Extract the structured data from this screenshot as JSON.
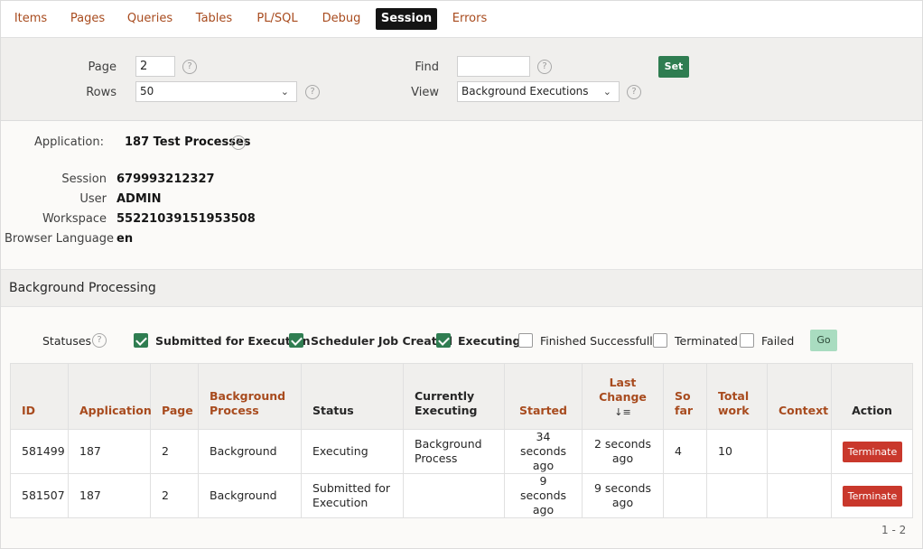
{
  "tabs": [
    "Items",
    "Pages",
    "Queries",
    "Tables",
    "PL/SQL",
    "Debug",
    "Session",
    "Errors"
  ],
  "active_tab": "Session",
  "filters": {
    "page_label": "Page",
    "page_value": "2",
    "rows_label": "Rows",
    "rows_value": "50",
    "find_label": "Find",
    "find_value": "",
    "view_label": "View",
    "view_value": "Background Executions",
    "set_label": "Set",
    "help_glyph": "?"
  },
  "info": {
    "application_label": "Application:",
    "application_value": "187 Test Processes",
    "session_label": "Session",
    "session_value": "679993212327",
    "user_label": "User",
    "user_value": "ADMIN",
    "workspace_label": "Workspace",
    "workspace_value": "55221039151953508",
    "language_label": "Browser Language",
    "language_value": "en"
  },
  "region": {
    "title": "Background Processing",
    "statuses_label": "Statuses",
    "go_label": "Go",
    "statuses": [
      {
        "label": "Submitted for Execution",
        "checked": true
      },
      {
        "label": "Scheduler Job Created",
        "checked": true
      },
      {
        "label": "Executing",
        "checked": true
      },
      {
        "label": "Finished Successfully",
        "checked": false
      },
      {
        "label": "Terminated",
        "checked": false
      },
      {
        "label": "Failed",
        "checked": false
      }
    ]
  },
  "table": {
    "headers": {
      "id": "ID",
      "application": "Application",
      "page": "Page",
      "bg_process_1": "Background",
      "bg_process_2": "Process",
      "status": "Status",
      "curr_1": "Currently",
      "curr_2": "Executing",
      "started": "Started",
      "last_1": "Last",
      "last_2": "Change",
      "sort_glyph": "↓≡",
      "so_1": "So",
      "so_2": "far",
      "total_1": "Total",
      "total_2": "work",
      "context": "Context",
      "action": "Action"
    },
    "rows": [
      {
        "id": "581499",
        "application": "187",
        "page": "2",
        "process": "Background",
        "status": "Executing",
        "current_1": "Background",
        "current_2": "Process",
        "started_1": "34 seconds",
        "started_2": "ago",
        "last_1": "2 seconds",
        "last_2": "ago",
        "so_far": "4",
        "total": "10",
        "context": "",
        "action": "Terminate"
      },
      {
        "id": "581507",
        "application": "187",
        "page": "2",
        "process": "Background",
        "status_1": "Submitted for",
        "status_2": "Execution",
        "current_1": "",
        "current_2": "",
        "started_1": "9 seconds",
        "started_2": "ago",
        "last_1": "9 seconds",
        "last_2": "ago",
        "so_far": "",
        "total": "",
        "context": "",
        "action": "Terminate"
      }
    ],
    "pagination": "1 - 2"
  },
  "colors": {
    "accent_link": "#a84b1e",
    "primary": "#2f7d51",
    "danger": "#c9382c"
  }
}
